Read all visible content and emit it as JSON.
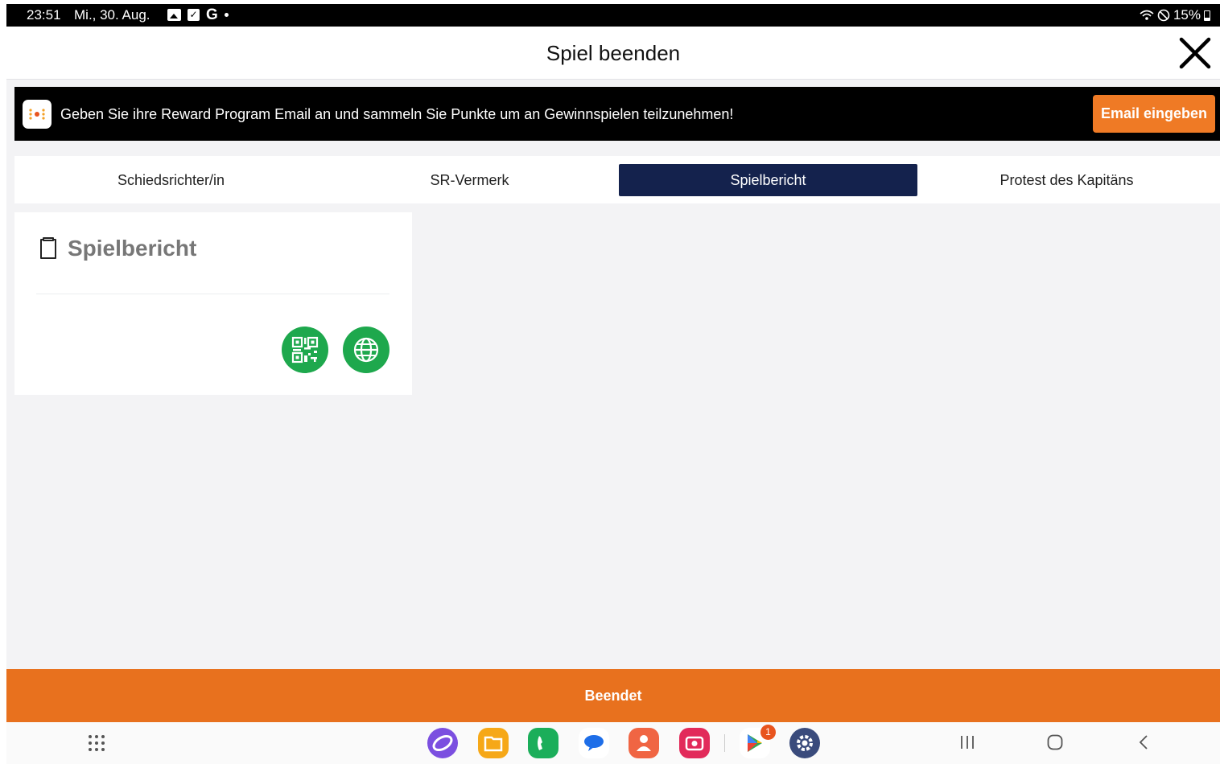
{
  "status_bar": {
    "time": "23:51",
    "date": "Mi., 30. Aug.",
    "google_letter": "G",
    "battery": "15%"
  },
  "header": {
    "title": "Spiel beenden"
  },
  "banner": {
    "text": "Geben Sie ihre Reward Program Email an und sammeln Sie Punkte um an Gewinnspielen teilzunehmen!",
    "button_label": "Email eingeben",
    "button_color": "#ef7a25"
  },
  "tabs": [
    {
      "label": "Schiedsrichter/in",
      "active": false
    },
    {
      "label": "SR-Vermerk",
      "active": false
    },
    {
      "label": "Spielbericht",
      "active": true
    },
    {
      "label": "Protest des Kapitäns",
      "active": false
    }
  ],
  "card": {
    "title": "Spielbericht",
    "icon": "clipboard-icon",
    "actions": [
      {
        "icon": "qr-code-icon",
        "color": "#1ea84d"
      },
      {
        "icon": "globe-icon",
        "color": "#1ea84d"
      }
    ]
  },
  "footer": {
    "button_label": "Beendet",
    "color": "#e8711e"
  },
  "navbar": {
    "dock_apps": [
      "internet-app-icon",
      "files-app-icon",
      "phone-app-icon",
      "messages-app-icon",
      "contacts-app-icon",
      "camera-app-icon",
      "play-store-app-icon",
      "settings-app-icon"
    ],
    "play_store_badge": "1",
    "accent_active_tab": "#14224d"
  }
}
